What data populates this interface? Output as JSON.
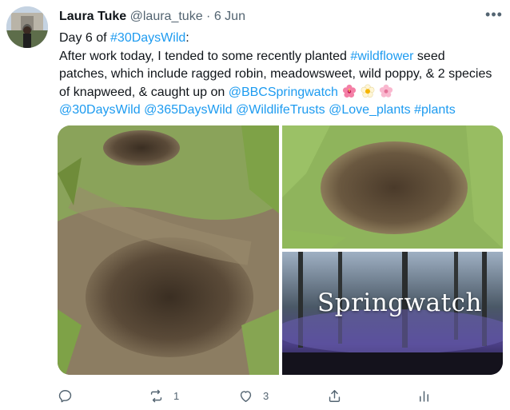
{
  "tweet": {
    "author_name": "Laura Tuke",
    "handle": "@laura_tuke",
    "separator": "·",
    "date": "6 Jun",
    "more_label": "•••",
    "text": {
      "line1_a": "Day 6 of ",
      "line1_tag": "#30DaysWild",
      "line1_b": ":",
      "line2_a": "After work today, I tended to some recently planted ",
      "line2_tag": "#wildflower",
      "line2_b": " seed",
      "line3": "patches, which include ragged robin, meadowsweet, wild poppy, & 2 species",
      "line4_a": "of knapweed, & caught up on ",
      "line4_mention": "@BBCSpringwatch",
      "line5_tag1": "@30DaysWild",
      "line5_tag2": "@365DaysWild",
      "line5_tag3": "@WildlifeTrusts",
      "line5_tag4": "@Love_plants",
      "line5_tag5": "#plants"
    },
    "emojis": [
      "hibiscus-icon",
      "blossom-icon",
      "cherry-blossom-icon"
    ],
    "media": {
      "springwatch_logo_text": "Springwatch"
    },
    "actions": {
      "reply_count": "",
      "retweet_count": "1",
      "like_count": "3",
      "share_count": "",
      "analytics_count": ""
    },
    "colors": {
      "link": "#1d9bf0",
      "secondary_text": "#536471",
      "primary_text": "#0f1419"
    }
  }
}
